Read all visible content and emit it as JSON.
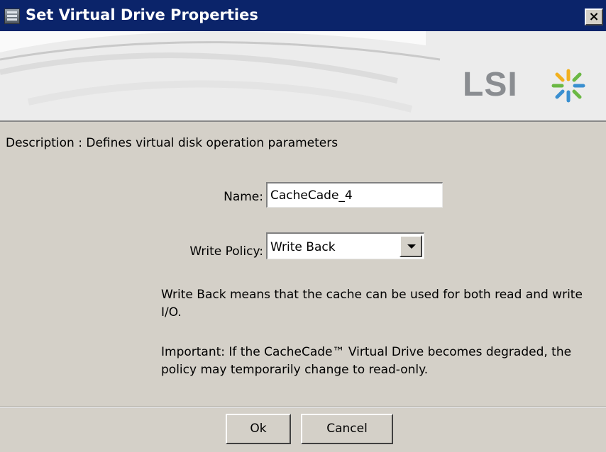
{
  "window": {
    "title": "Set Virtual Drive Properties",
    "close_label": "×"
  },
  "banner": {
    "logo_text": "LSI"
  },
  "content": {
    "description": "Description : Defines virtual disk operation parameters",
    "name_label": "Name:",
    "name_value": "CacheCade_4",
    "write_policy_label": "Write Policy:",
    "write_policy_value": "Write Back",
    "help_text_1": "Write Back means that the cache can be used for both read and write I/O.",
    "help_text_2": "Important: If the CacheCade™ Virtual Drive becomes degraded, the policy may temporarily change to read-only."
  },
  "buttons": {
    "ok_label": "Ok",
    "cancel_label": "Cancel"
  },
  "colors": {
    "titlebar": "#0b246a",
    "dialog_bg": "#d4d0c8",
    "banner_bg": "#ececec"
  }
}
